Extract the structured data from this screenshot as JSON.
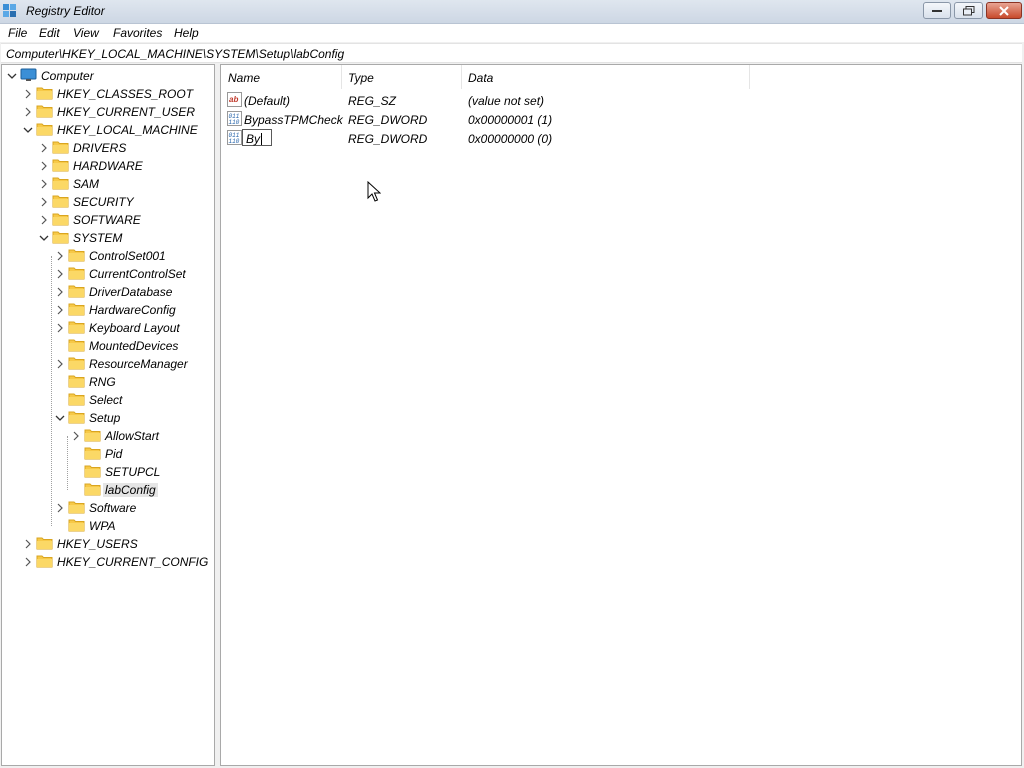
{
  "window": {
    "title": "Registry Editor",
    "icon": "registry-editor-icon"
  },
  "menu": {
    "items": [
      "File",
      "Edit",
      "View",
      "Favorites",
      "Help"
    ]
  },
  "address": {
    "path": "Computer\\HKEY_LOCAL_MACHINE\\SYSTEM\\Setup\\labConfig"
  },
  "tree": {
    "root": "Computer",
    "nodes": [
      {
        "label": "Computer",
        "depth": 0,
        "expander": "open",
        "icon": "computer-icon"
      },
      {
        "label": "HKEY_CLASSES_ROOT",
        "depth": 1,
        "expander": "closed"
      },
      {
        "label": "HKEY_CURRENT_USER",
        "depth": 1,
        "expander": "closed"
      },
      {
        "label": "HKEY_LOCAL_MACHINE",
        "depth": 1,
        "expander": "open"
      },
      {
        "label": "DRIVERS",
        "depth": 2,
        "expander": "closed"
      },
      {
        "label": "HARDWARE",
        "depth": 2,
        "expander": "closed"
      },
      {
        "label": "SAM",
        "depth": 2,
        "expander": "closed"
      },
      {
        "label": "SECURITY",
        "depth": 2,
        "expander": "closed"
      },
      {
        "label": "SOFTWARE",
        "depth": 2,
        "expander": "closed"
      },
      {
        "label": "SYSTEM",
        "depth": 2,
        "expander": "open"
      },
      {
        "label": "ControlSet001",
        "depth": 3,
        "expander": "closed"
      },
      {
        "label": "CurrentControlSet",
        "depth": 3,
        "expander": "closed"
      },
      {
        "label": "DriverDatabase",
        "depth": 3,
        "expander": "closed"
      },
      {
        "label": "HardwareConfig",
        "depth": 3,
        "expander": "closed"
      },
      {
        "label": "Keyboard Layout",
        "depth": 3,
        "expander": "closed"
      },
      {
        "label": "MountedDevices",
        "depth": 3,
        "expander": "none"
      },
      {
        "label": "ResourceManager",
        "depth": 3,
        "expander": "closed"
      },
      {
        "label": "RNG",
        "depth": 3,
        "expander": "none"
      },
      {
        "label": "Select",
        "depth": 3,
        "expander": "none"
      },
      {
        "label": "Setup",
        "depth": 3,
        "expander": "open"
      },
      {
        "label": "AllowStart",
        "depth": 4,
        "expander": "closed"
      },
      {
        "label": "Pid",
        "depth": 4,
        "expander": "none"
      },
      {
        "label": "SETUPCL",
        "depth": 4,
        "expander": "none"
      },
      {
        "label": "labConfig",
        "depth": 4,
        "expander": "none",
        "selected": true
      },
      {
        "label": "Software",
        "depth": 3,
        "expander": "closed"
      },
      {
        "label": "WPA",
        "depth": 3,
        "expander": "none"
      },
      {
        "label": "HKEY_USERS",
        "depth": 1,
        "expander": "closed"
      },
      {
        "label": "HKEY_CURRENT_CONFIG",
        "depth": 1,
        "expander": "closed"
      }
    ]
  },
  "list": {
    "columns": [
      "Name",
      "Type",
      "Data"
    ],
    "rows": [
      {
        "name": "(Default)",
        "type": "REG_SZ",
        "data": "(value not set)",
        "icon": "string-value-icon"
      },
      {
        "name": "BypassTPMCheck",
        "type": "REG_DWORD",
        "data": "0x00000001 (1)",
        "icon": "binary-value-icon"
      },
      {
        "name": "By",
        "type": "REG_DWORD",
        "data": "0x00000000 (0)",
        "icon": "binary-value-icon",
        "editing": true
      }
    ]
  },
  "colors": {
    "selection": "#e5e5e5",
    "folder": "#f7c948",
    "computer": "#3b8fd6",
    "close_button": "#c84a2c"
  }
}
